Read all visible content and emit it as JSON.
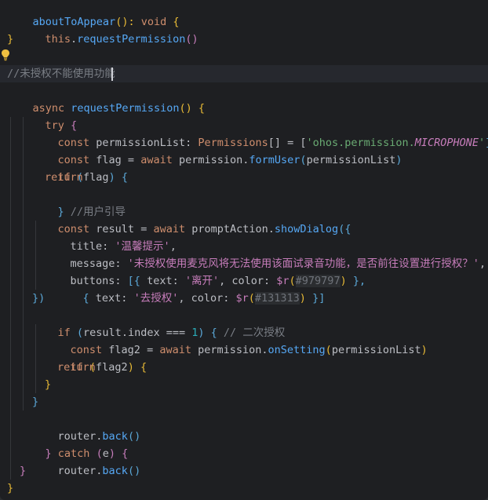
{
  "lines": {
    "l0_a": "aboutToAppear",
    "l0_b": "(): ",
    "l0_c": "void",
    "l0_d": " {",
    "l1_a": "this",
    "l1_b": ".",
    "l1_c": "requestPermission",
    "l1_d": "()",
    "l2": "}",
    "l4": "//未授权不能使用功能",
    "l5_a": "async ",
    "l5_b": "requestPermission",
    "l5_c": "() {",
    "l6_a": "try",
    "l6_b": " {",
    "l7_a": "const ",
    "l7_b": "permissionList: ",
    "l7_c": "Permissions",
    "l7_d": "[] = [",
    "l7_e": "'ohos.permission.",
    "l7_f": "MICROPHONE",
    "l7_g": "'",
    "l7_h": "]",
    "l8_a": "const ",
    "l8_b": "flag = ",
    "l8_c": "await ",
    "l8_d": "permission.",
    "l8_e": "formUser",
    "l8_f": "(",
    "l8_g": "permissionList",
    "l8_h": ")",
    "l9_a": "if ",
    "l9_b": "(",
    "l9_c": "flag",
    "l9_d": ")",
    "l9_e": " {",
    "l10": "return",
    "l11_a": "}",
    "l11_b": " //用户引导",
    "l12_a": "const ",
    "l12_b": "result = ",
    "l12_c": "await ",
    "l12_d": "promptAction.",
    "l12_e": "showDialog",
    "l12_f": "({",
    "l13_a": "title: ",
    "l13_b": "'温馨提示'",
    "l13_c": ",",
    "l14_a": "message: ",
    "l14_b": "'未授权使用麦克风将无法使用该面试录音功能，是否前往设置进行授权？'",
    "l14_c": ",",
    "l15_a": "buttons: ",
    "l15_b": "[{ ",
    "l15_c": "text: ",
    "l15_d": "'离开'",
    "l15_e": ", color: ",
    "l15_f": "$r",
    "l15_g": "(",
    "l15_h": "#979797",
    "l15_i": ")",
    "l15_j": " },",
    "l16_a": "{ ",
    "l16_b": "text: ",
    "l16_c": "'去授权'",
    "l16_d": ", color: ",
    "l16_e": "$r",
    "l16_f": "(",
    "l16_g": "#131313",
    "l16_h": ")",
    "l16_i": " }]",
    "l17": "})",
    "l18_a": "if ",
    "l18_b": "(",
    "l18_c": "result.index === ",
    "l18_d": "1",
    "l18_e": ")",
    "l18_f": " { ",
    "l18_g": "// 二次授权",
    "l19_a": "const ",
    "l19_b": "flag2 = ",
    "l19_c": "await ",
    "l19_d": "permission.",
    "l19_e": "onSetting",
    "l19_f": "(",
    "l19_g": "permissionList",
    "l19_h": ")",
    "l20_a": "if ",
    "l20_b": "(",
    "l20_c": "flag2",
    "l20_d": ")",
    "l20_e": " {",
    "l21": "return",
    "l22": "}",
    "l23": "}",
    "l24_a": "router.",
    "l24_b": "back",
    "l24_c": "()",
    "l25_a": "} ",
    "l25_b": "catch ",
    "l25_c": "(",
    "l25_d": "e",
    "l25_e": ")",
    "l25_f": " {",
    "l26_a": "router.",
    "l26_b": "back",
    "l26_c": "()",
    "l27": "}",
    "l28": "}"
  },
  "colors": {
    "background": "#1e1f22",
    "keyword": "#cf8e6d",
    "function": "#56a8f5",
    "string": "#6aab73",
    "comment": "#7a7e85",
    "number": "#2aacb8",
    "bracket_yellow": "#e8ba36",
    "bracket_purple": "#c77dbb",
    "bracket_blue": "#5ba8d8"
  },
  "icons": {
    "gutter": "intention-bulb-icon"
  }
}
